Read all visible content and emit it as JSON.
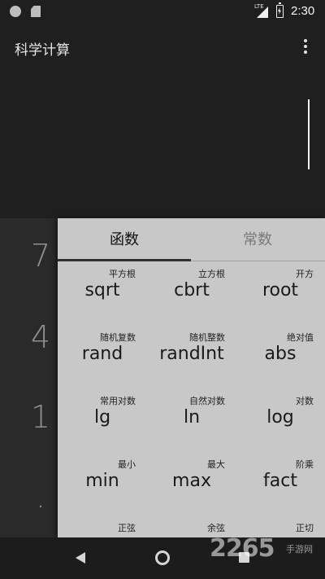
{
  "status_bar": {
    "network": "LTE",
    "time": "2:30"
  },
  "app_bar": {
    "title": "科学计算",
    "menu_icon": "more-vert-icon"
  },
  "keypad": {
    "digits": [
      "7",
      "4",
      "1",
      "."
    ]
  },
  "function_panel": {
    "tabs": [
      {
        "label": "函数",
        "active": true
      },
      {
        "label": "常数",
        "active": false
      }
    ],
    "functions": [
      {
        "sub": "平方根",
        "label": "sqrt"
      },
      {
        "sub": "立方根",
        "label": "cbrt"
      },
      {
        "sub": "开方",
        "label": "root"
      },
      {
        "sub": "随机复数",
        "label": "rand"
      },
      {
        "sub": "随机整数",
        "label": "randInt"
      },
      {
        "sub": "绝对值",
        "label": "abs"
      },
      {
        "sub": "常用对数",
        "label": "lg"
      },
      {
        "sub": "自然对数",
        "label": "ln"
      },
      {
        "sub": "对数",
        "label": "log"
      },
      {
        "sub": "最小",
        "label": "min"
      },
      {
        "sub": "最大",
        "label": "max"
      },
      {
        "sub": "阶乘",
        "label": "fact"
      },
      {
        "sub": "正弦",
        "label": ""
      },
      {
        "sub": "余弦",
        "label": ""
      },
      {
        "sub": "正切",
        "label": ""
      }
    ]
  },
  "watermark": {
    "text": "2265",
    "sub": "手游网"
  }
}
